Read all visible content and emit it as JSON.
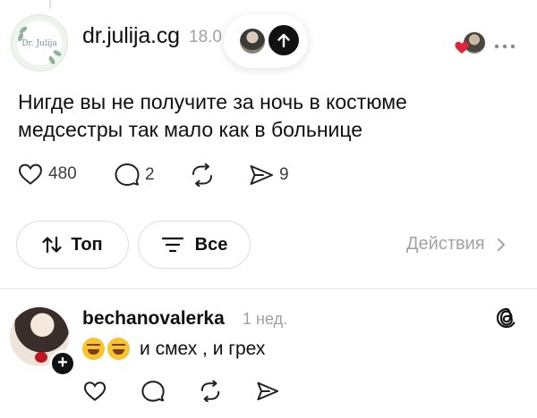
{
  "post": {
    "avatar_logo_text": "Dr. Julija",
    "username": "dr.julija.cg",
    "time": "18.0",
    "text_line1": "Нигде вы не получите за ночь в костюме",
    "text_line2": "медсестры так мало как в больнице",
    "likes": "480",
    "comments": "2",
    "shares": "9",
    "icons": {
      "repost": "arrow-up-icon",
      "more": "more-dots-icon",
      "like": "heart-icon",
      "comment": "comment-icon",
      "repost_action": "repost-icon",
      "share": "share-icon"
    }
  },
  "filters": {
    "sort_label": "Топ",
    "view_label": "Все",
    "actions_label": "Действия"
  },
  "comment": {
    "username": "bechanovalerka",
    "time": "1 нед.",
    "text": "и смех , и грех",
    "emojis": [
      "rofl",
      "rofl"
    ]
  },
  "colors": {
    "text": "#101010",
    "muted": "#a0a0a0",
    "border": "#dcdcdc",
    "heart_red": "#e0243a"
  }
}
